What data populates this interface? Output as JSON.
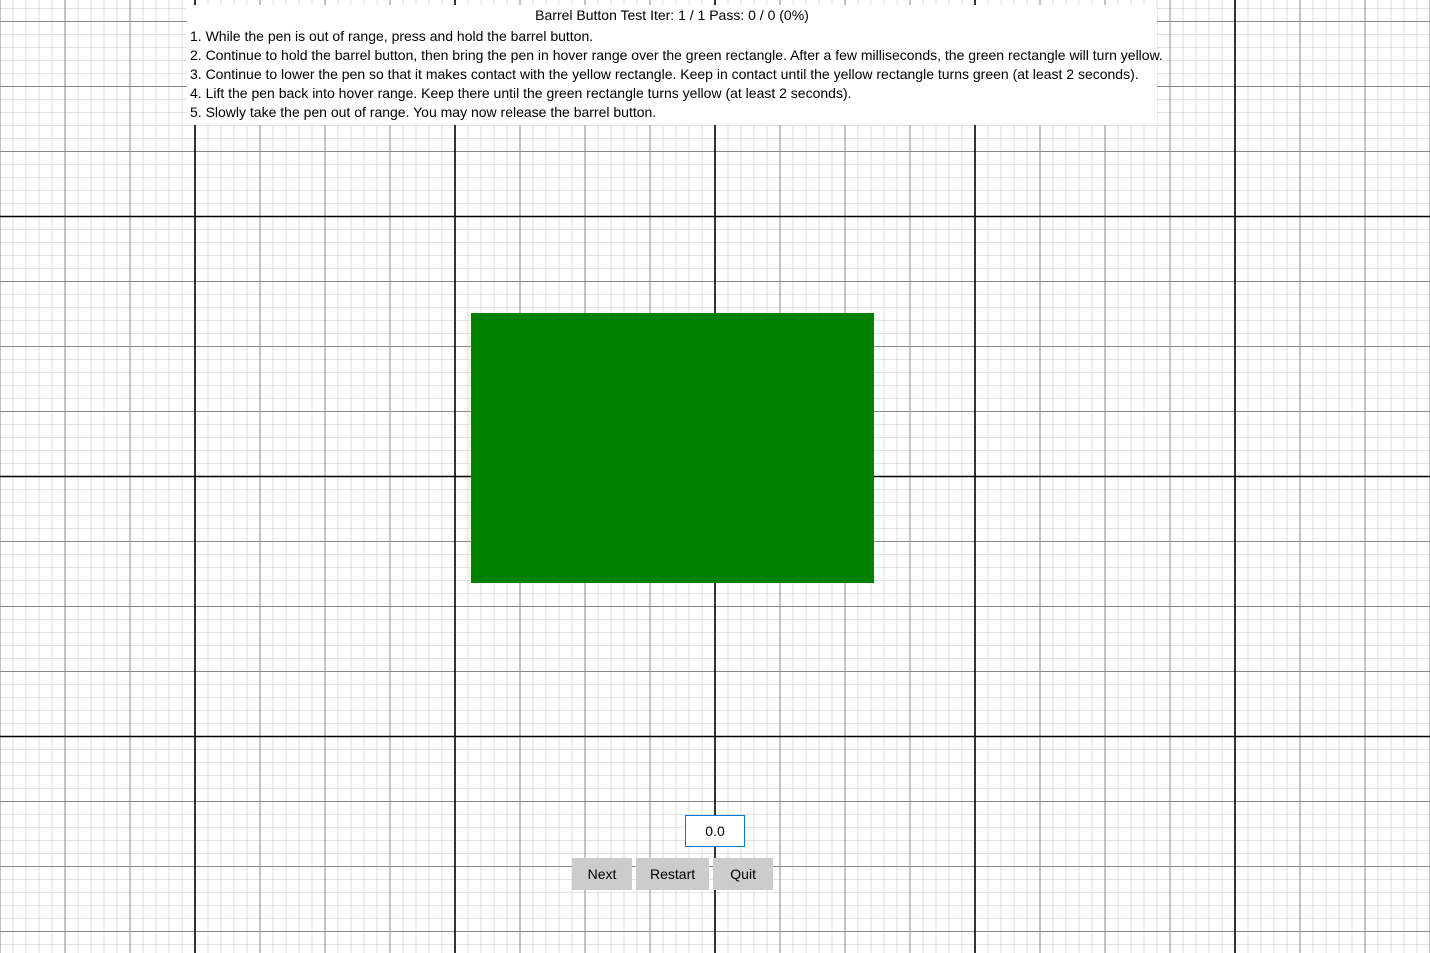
{
  "header": {
    "title_line": "Barrel Button Test   Iter: 1 / 1   Pass: 0 / 0 (0%)",
    "instructions": [
      "1. While the pen is out of range, press and hold the barrel button.",
      "2. Continue to hold the barrel button, then bring the pen in hover range over the green rectangle. After a few milliseconds, the green rectangle will turn yellow.",
      "3. Continue to lower the pen so that it makes contact with the yellow rectangle. Keep in contact until the yellow rectangle turns green (at least 2 seconds).",
      "4. Lift the pen back into hover range. Keep there until the green rectangle turns yellow (at least 2 seconds).",
      "5. Slowly take the pen out of range. You may now release the barrel button."
    ]
  },
  "target": {
    "color": "#008000"
  },
  "readout": {
    "value": "0.0"
  },
  "buttons": {
    "next": "Next",
    "restart": "Restart",
    "quit": "Quit"
  },
  "grid": {
    "minor_color": "#c8c8c8",
    "major_color": "#888888",
    "axis_color": "#000000",
    "minor_spacing": 13,
    "major_group": 5
  }
}
